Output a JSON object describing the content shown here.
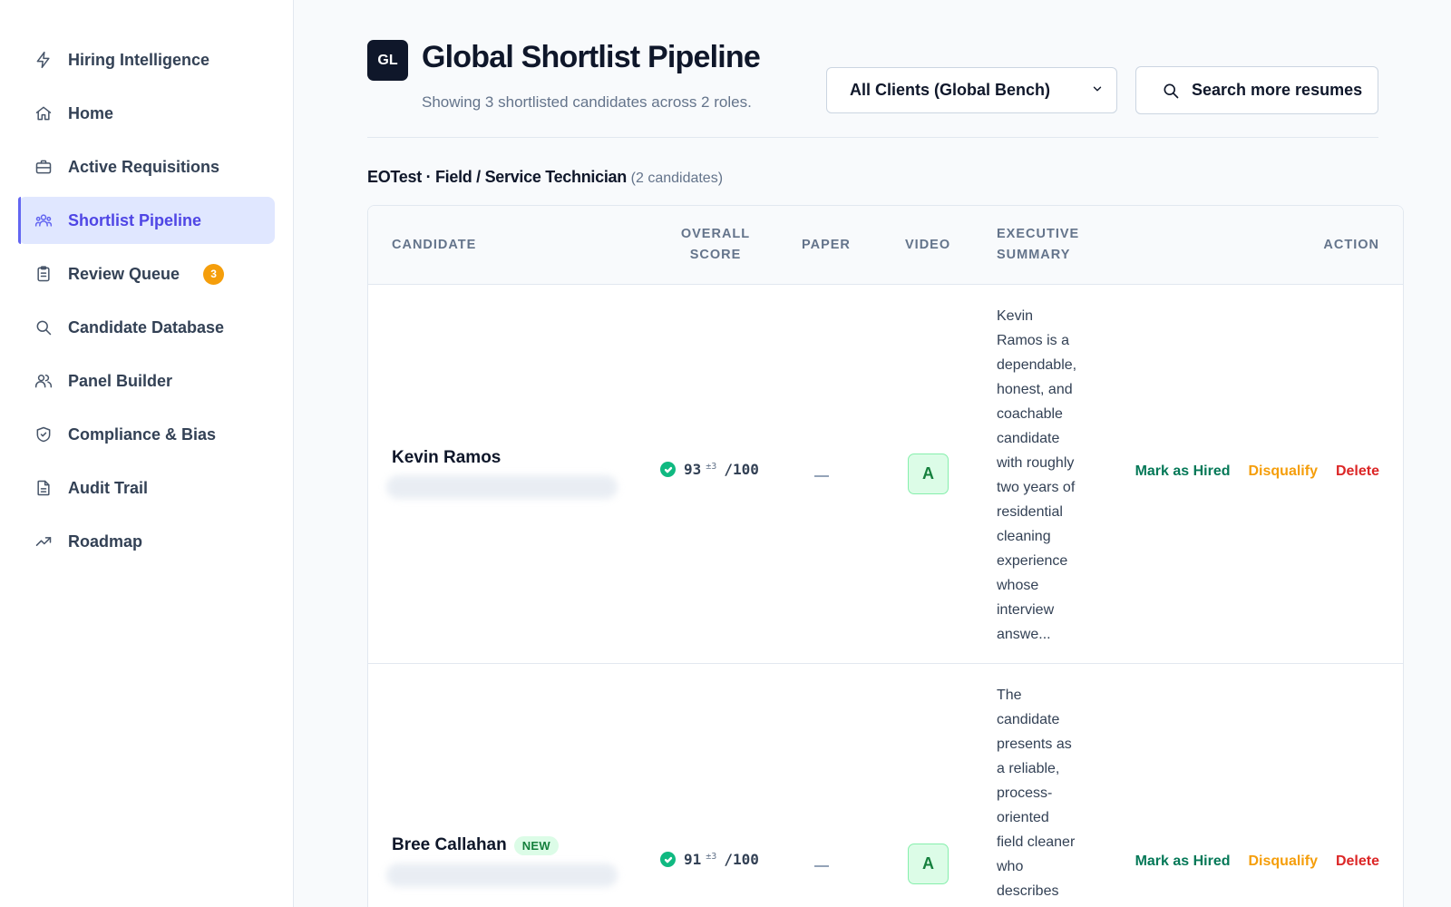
{
  "sidebar": {
    "items": [
      {
        "label": "Hiring Intelligence",
        "icon": "bolt-icon"
      },
      {
        "label": "Home",
        "icon": "home-icon"
      },
      {
        "label": "Active Requisitions",
        "icon": "briefcase-icon"
      },
      {
        "label": "Shortlist Pipeline",
        "icon": "users-icon",
        "active": true
      },
      {
        "label": "Review Queue",
        "icon": "clipboard-icon",
        "badge": "3"
      },
      {
        "label": "Candidate Database",
        "icon": "search-icon"
      },
      {
        "label": "Panel Builder",
        "icon": "user-group-icon"
      },
      {
        "label": "Compliance & Bias",
        "icon": "shield-check-icon"
      },
      {
        "label": "Audit Trail",
        "icon": "document-icon"
      },
      {
        "label": "Roadmap",
        "icon": "trending-up-icon"
      }
    ]
  },
  "header": {
    "logo": "GL",
    "title": "Global Shortlist Pipeline",
    "subtitle": "Showing 3 shortlisted candidates across 2 roles.",
    "client_select": "All Clients (Global Bench)",
    "search_button": "Search more resumes"
  },
  "section": {
    "title": "EOTest · Field / Service Technician",
    "count": "(2 candidates)"
  },
  "table": {
    "columns": {
      "candidate": "Candidate",
      "score_l1": "Overall",
      "score_l2": "Score",
      "paper": "Paper",
      "video": "Video",
      "summary_l1": "Executive",
      "summary_l2": "Summary",
      "action": "Action"
    },
    "rows": [
      {
        "name": "Kevin Ramos",
        "badge": "",
        "score": "93",
        "margin": "±3",
        "max": "/100",
        "video_grade": "A",
        "summary_lines": [
          "Kevin",
          "Ramos is a",
          "dependable,",
          "honest, and",
          "coachable",
          "candidate",
          "with roughly",
          "two years of",
          "residential",
          "cleaning",
          "experience",
          "whose",
          "interview",
          "answe..."
        ],
        "actions": {
          "hire": "Mark as Hired",
          "disqualify": "Disqualify",
          "delete": "Delete"
        }
      },
      {
        "name": "Bree Callahan",
        "badge": "NEW",
        "score": "91",
        "margin": "±3",
        "max": "/100",
        "video_grade": "A",
        "summary_lines": [
          "The",
          "candidate",
          "presents as",
          "a reliable,",
          "process-",
          "oriented",
          "field cleaner",
          "who",
          "describes"
        ],
        "actions": {
          "hire": "Mark as Hired",
          "disqualify": "Disqualify",
          "delete": "Delete"
        }
      }
    ]
  },
  "colors": {
    "accent": "#4f46e5",
    "accent_bg": "#e0e7ff",
    "success": "#047857",
    "warning": "#f59e0b",
    "danger": "#dc2626"
  }
}
